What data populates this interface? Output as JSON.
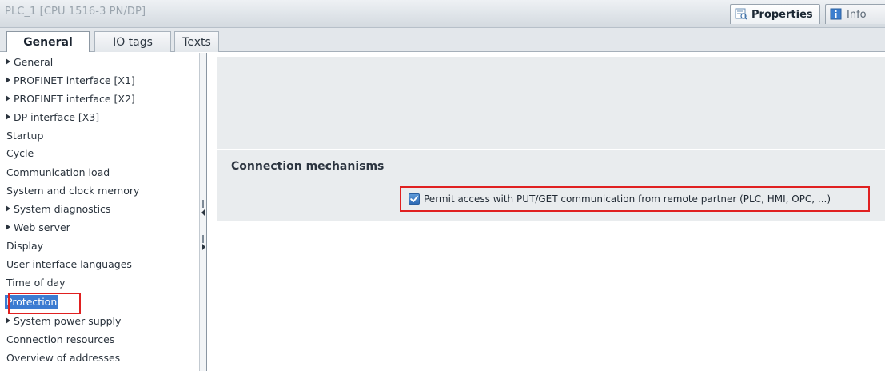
{
  "window": {
    "title": "PLC_1 [CPU 1516-3 PN/DP]"
  },
  "top_tabs": [
    {
      "label": "Properties",
      "icon": "properties-icon"
    },
    {
      "label": "Info",
      "icon": "info-icon"
    }
  ],
  "sub_tabs": [
    {
      "label": "General"
    },
    {
      "label": "IO tags"
    },
    {
      "label": "Texts"
    }
  ],
  "nav": {
    "items": [
      {
        "label": "General",
        "expandable": true
      },
      {
        "label": "PROFINET interface [X1]",
        "expandable": true
      },
      {
        "label": "PROFINET interface [X2]",
        "expandable": true
      },
      {
        "label": "DP interface [X3]",
        "expandable": true
      },
      {
        "label": "Startup",
        "expandable": false
      },
      {
        "label": "Cycle",
        "expandable": false
      },
      {
        "label": "Communication load",
        "expandable": false
      },
      {
        "label": "System and clock memory",
        "expandable": false
      },
      {
        "label": "System diagnostics",
        "expandable": true
      },
      {
        "label": "Web server",
        "expandable": true
      },
      {
        "label": "Display",
        "expandable": false
      },
      {
        "label": "User interface languages",
        "expandable": false
      },
      {
        "label": "Time of day",
        "expandable": false
      },
      {
        "label": "Protection",
        "expandable": false,
        "selected": true
      },
      {
        "label": "System power supply",
        "expandable": true
      },
      {
        "label": "Connection resources",
        "expandable": false
      },
      {
        "label": "Overview of addresses",
        "expandable": false
      }
    ]
  },
  "content": {
    "section_title": "Connection mechanisms",
    "permit_label": "Permit access with PUT/GET communication from remote partner (PLC, HMI, OPC, ...)",
    "permit_checked": true
  },
  "colors": {
    "selection": "#3b7bd1",
    "highlight_outline": "#e02020",
    "checkbox": "#2e6ab5"
  }
}
